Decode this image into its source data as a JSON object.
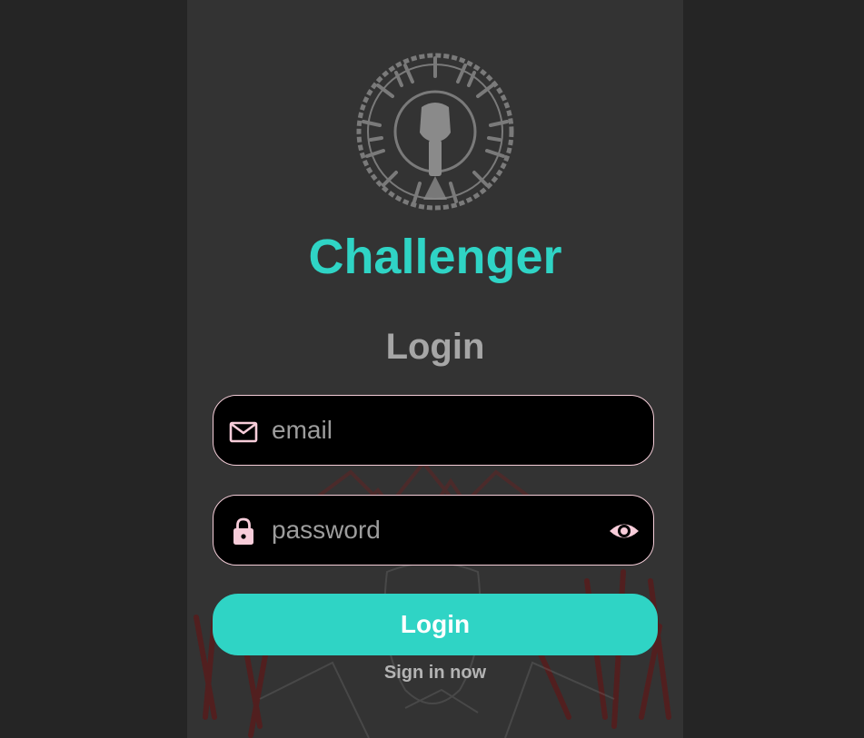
{
  "app": {
    "title": "Challenger",
    "logo_icon": "fist-emblem-icon"
  },
  "page": {
    "heading": "Login"
  },
  "form": {
    "email": {
      "value": "",
      "placeholder": "email",
      "icon": "mail-icon"
    },
    "password": {
      "value": "",
      "placeholder": "password",
      "icon": "lock-icon",
      "toggle_icon": "eye-icon"
    },
    "submit_label": "Login",
    "signup_link": "Sign in now"
  },
  "colors": {
    "accent": "#2fd4c5",
    "panel_background": "#333333",
    "outer_background": "#252525",
    "field_background": "#000000",
    "field_border": "#f4cdd8",
    "icon_pink": "#f8cdda",
    "heading_gray": "#a6a6a6"
  }
}
